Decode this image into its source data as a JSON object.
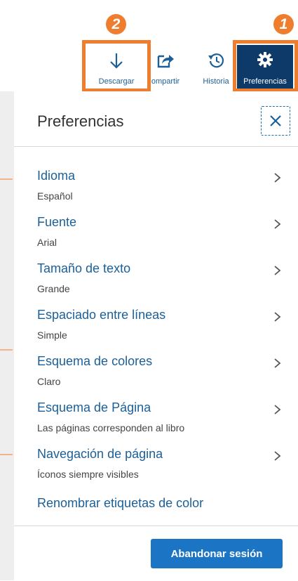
{
  "toolbar": {
    "download_label": "Descargar",
    "share_label": "ompartir",
    "history_label": "Historia",
    "preferences_label": "Preferencias"
  },
  "annotations": {
    "badge_1": "1",
    "badge_2": "2"
  },
  "panel": {
    "title": "Preferencias",
    "items": [
      {
        "label": "Idioma",
        "value": "Español",
        "icon": "chevron-right-icon"
      },
      {
        "label": "Fuente",
        "value": "Arial",
        "icon": "chevron-right-icon"
      },
      {
        "label": "Tamaño de texto",
        "value": "Grande",
        "icon": "chevron-right-icon"
      },
      {
        "label": "Espaciado entre líneas",
        "value": "Simple",
        "icon": "chevron-right-icon"
      },
      {
        "label": "Esquema de colores",
        "value": "Claro",
        "icon": "chevron-right-icon"
      },
      {
        "label": "Esquema de Página",
        "value": "Las páginas corresponden al libro",
        "icon": "chevron-right-icon"
      },
      {
        "label": "Navegación de página",
        "value": "Íconos siempre visibles",
        "icon": "chevron-right-icon"
      }
    ],
    "rename_link": "Renombrar etiquetas de color",
    "logout_label": "Abandonar sesión"
  },
  "colors": {
    "highlight": "#ee7d2e",
    "accent_blue": "#1c74c4",
    "link_blue": "#1b5f98",
    "active_bg": "#0d3a68"
  }
}
